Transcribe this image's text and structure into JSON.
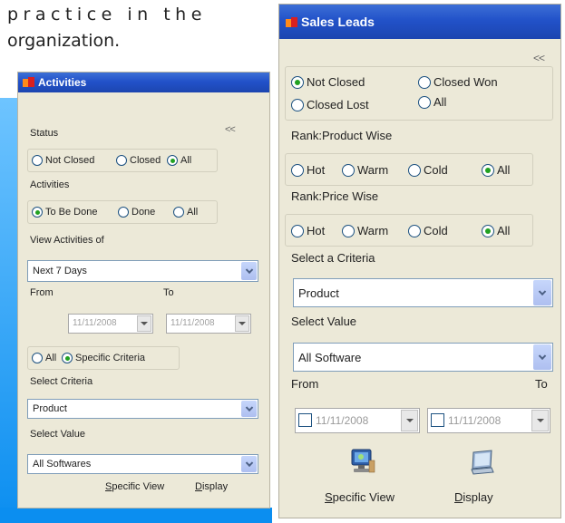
{
  "caption": {
    "line1": "practice in the",
    "line2": "organization."
  },
  "activities": {
    "title": "Activities",
    "collapse": "<<",
    "status_label": "Status",
    "status_options": [
      "Not Closed",
      "Closed",
      "All"
    ],
    "activities_label": "Activities",
    "activities_options": [
      "To Be Done",
      "Done",
      "All"
    ],
    "view_label": "View Activities of",
    "view_value": "Next 7 Days",
    "from_label": "From",
    "to_label": "To",
    "from_date": "11/11/2008",
    "to_date": "11/11/2008",
    "criteria_options": [
      "All",
      "Specific Criteria"
    ],
    "select_criteria_label": "Select Criteria",
    "criteria_value": "Product",
    "select_value_label": "Select Value",
    "value_value": "All Softwares",
    "specific_view": "Specific View",
    "display": "Display"
  },
  "sales": {
    "title": "Sales Leads",
    "collapse": "<<",
    "status_options": [
      "Not Closed",
      "Closed Won",
      "Closed Lost",
      "All"
    ],
    "product_rank_label": "Rank:Product Wise",
    "product_rank_options": [
      "Hot",
      "Warm",
      "Cold",
      "All"
    ],
    "price_rank_label": "Rank:Price Wise",
    "price_rank_options": [
      "Hot",
      "Warm",
      "Cold",
      "All"
    ],
    "criteria_label": "Select a Criteria",
    "criteria_value": "Product",
    "value_label": "Select Value",
    "value_value": "All Software",
    "from_label": "From",
    "to_label": "To",
    "from_date": "11/11/2008",
    "to_date": "11/11/2008",
    "specific_view": "Specific View",
    "display": "Display"
  },
  "icons": {
    "specific_view": "computer-icon",
    "display": "display-icon"
  }
}
